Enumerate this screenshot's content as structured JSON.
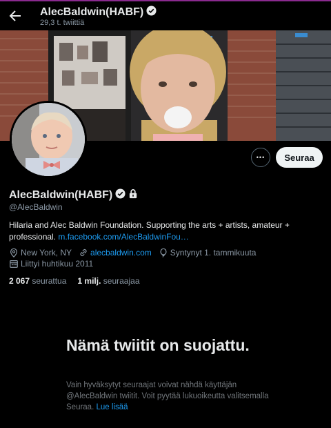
{
  "header": {
    "name": "AlecBaldwin(HABF)",
    "tweet_count": "29,3 t. twiittiä"
  },
  "profile": {
    "name": "AlecBaldwin(HABF)",
    "handle": "@AlecBaldwin",
    "bio_text": "Hilaria and Alec Baldwin Foundation. Supporting the arts + artists, amateur + professional. ",
    "bio_link": "m.facebook.com/AlecBaldwinFou…",
    "location": "New York, NY",
    "website": "alecbaldwin.com",
    "birthday": "Syntynyt 1. tammikuuta",
    "joined": "Liittyi huhtikuu 2011",
    "following_count": "2 067",
    "following_label": "seurattua",
    "followers_count": "1 milj.",
    "followers_label": "seuraajaa"
  },
  "actions": {
    "follow_label": "Seuraa",
    "more_label": "•••"
  },
  "protected": {
    "title": "Nämä twiitit on suojattu.",
    "text": "Vain hyväksytyt seuraajat voivat nähdä käyttäjän @AlecBaldwin twiitit. Voit pyytää lukuoikeutta valitsemalla Seuraa. ",
    "link": "Lue lisää"
  },
  "colors": {
    "background": "#000000",
    "accent": "#1d9bf0",
    "secondary_text": "#8b98a5",
    "top_border": "#8a2a8f"
  },
  "icons": {
    "back": "arrow-left-icon",
    "verified": "verified-badge-icon",
    "lock": "lock-icon",
    "location": "location-pin-icon",
    "link": "link-icon",
    "birthday": "balloon-icon",
    "calendar": "calendar-icon"
  }
}
